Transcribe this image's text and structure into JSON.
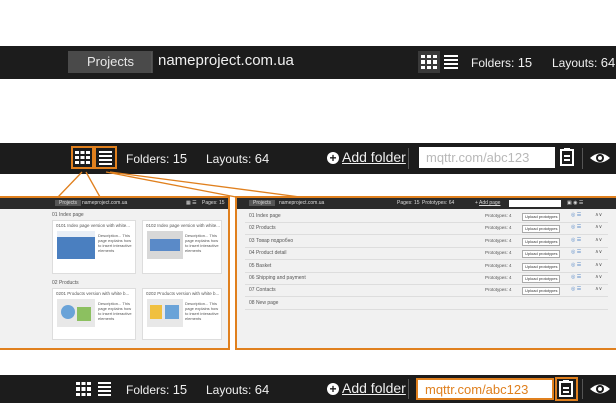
{
  "bar1": {
    "projects_label": "Projects",
    "project_name": "nameproject.com.ua",
    "folders_label": "Folders:",
    "folders_count": "15",
    "layouts_label": "Layouts:",
    "layouts_count": "64"
  },
  "bar2": {
    "folders_label": "Folders:",
    "folders_count": "15",
    "layouts_label": "Layouts:",
    "layouts_count": "64",
    "add_folder": "Add folder",
    "url_value": "mqttr.com/abc123"
  },
  "bar3": {
    "folders_label": "Folders:",
    "folders_count": "15",
    "layouts_label": "Layouts:",
    "layouts_count": "64",
    "add_folder": "Add folder",
    "url_value": "mqttr.com/abc123"
  },
  "grid_panel": {
    "projects_label": "Projects",
    "project_name": "nameproject.com.ua",
    "pages_label": "Pages:",
    "pages_count": "15",
    "sections": [
      {
        "title": "01 Index page",
        "cards": [
          {
            "title": "0101 Index page version with white...",
            "desc": "Description... This page explains how to insert interactive elements"
          },
          {
            "title": "0102 Index page version with white...",
            "desc": "Description... This page explains how to insert interactive elements"
          }
        ]
      },
      {
        "title": "02 Products",
        "cards": [
          {
            "title": "0201 Products version with white b...",
            "desc": "Description... This page explains how to insert interactive elements"
          },
          {
            "title": "0202 Products version with white b...",
            "desc": "Description... This page explains how to insert interactive elements"
          }
        ]
      }
    ]
  },
  "list_panel": {
    "projects_label": "Projects",
    "project_name": "nameproject.com.ua",
    "pages_label": "Pages:",
    "pages_count": "15",
    "prototypes_label": "Prototypes:",
    "prototypes_count": "64",
    "add_page": "Add page",
    "rows": [
      {
        "name": "01 Index page",
        "count": "Prototypes: 4",
        "action": "Upload prototypes"
      },
      {
        "name": "02 Products",
        "count": "Prototypes: 4",
        "action": "Upload prototypes"
      },
      {
        "name": "03 Товар подробно",
        "count": "Prototypes: 4",
        "action": "Upload prototypes"
      },
      {
        "name": "04 Product detail",
        "count": "Prototypes: 4",
        "action": "Upload prototypes"
      },
      {
        "name": "05 Basket",
        "count": "Prototypes: 4",
        "action": "Upload prototypes"
      },
      {
        "name": "06 Shipping and payment",
        "count": "Prototypes: 4",
        "action": "Upload prototypes"
      },
      {
        "name": "07 Contacts",
        "count": "Prototypes: 4",
        "action": "Upload prototypes"
      },
      {
        "name": "08 New page",
        "count": "",
        "action": ""
      }
    ]
  },
  "colors": {
    "bar_bg": "#1c1c1c",
    "accent": "#e0801e"
  }
}
